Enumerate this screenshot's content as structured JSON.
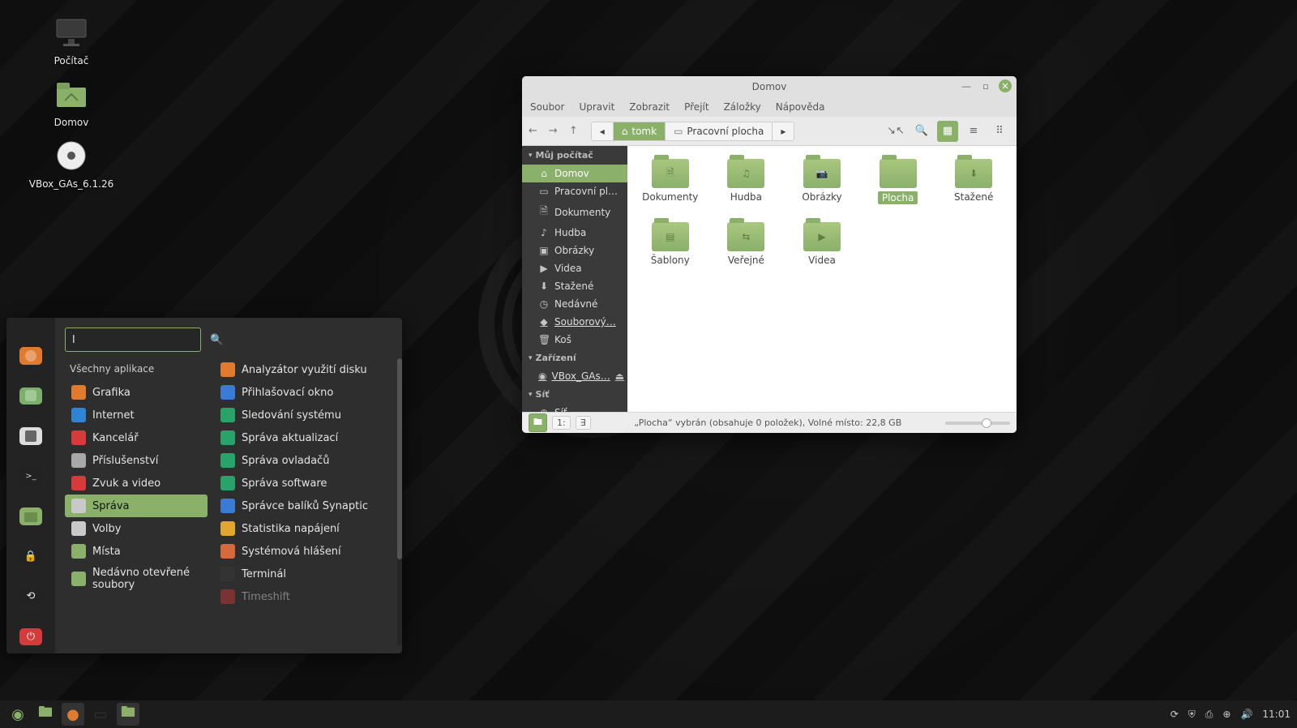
{
  "desktop": {
    "icons": [
      {
        "name": "computer",
        "label": "Počítač"
      },
      {
        "name": "home",
        "label": "Domov"
      },
      {
        "name": "disc",
        "label": "VBox_GAs_6.1.26"
      }
    ]
  },
  "start_menu": {
    "search_value": "l",
    "heading": "Všechny aplikace",
    "rail": [
      "firefox",
      "software",
      "settings",
      "terminal",
      "files",
      "lock",
      "logout",
      "power"
    ],
    "categories": [
      {
        "id": "grafika",
        "label": "Grafika",
        "color": "#e07a2f"
      },
      {
        "id": "internet",
        "label": "Internet",
        "color": "#2f84d6"
      },
      {
        "id": "kancelar",
        "label": "Kancelář",
        "color": "#d63a3a"
      },
      {
        "id": "prislusenstvi",
        "label": "Příslušenství",
        "color": "#a8a8a8"
      },
      {
        "id": "zvuk-video",
        "label": "Zvuk a video",
        "color": "#d63a3a"
      },
      {
        "id": "sprava",
        "label": "Správa",
        "color": "#c9c9c9",
        "selected": true
      },
      {
        "id": "volby",
        "label": "Volby",
        "color": "#c9c9c9"
      },
      {
        "id": "mista",
        "label": "Místa",
        "color": "#8ab06a"
      },
      {
        "id": "nedavno",
        "label": "Nedávno otevřené soubory",
        "color": "#8ab06a"
      }
    ],
    "apps": [
      {
        "id": "disk-usage",
        "label": "Analyzátor využití disku",
        "color": "#e07a2f"
      },
      {
        "id": "login-window",
        "label": "Přihlašovací okno",
        "color": "#3a7bd6"
      },
      {
        "id": "sys-monitor",
        "label": "Sledování systému",
        "color": "#2aa36a"
      },
      {
        "id": "update-mgr",
        "label": "Správa aktualizací",
        "color": "#2aa36a"
      },
      {
        "id": "driver-mgr",
        "label": "Správa ovladačů",
        "color": "#2aa36a"
      },
      {
        "id": "software-mgr",
        "label": "Správa software",
        "color": "#2aa36a"
      },
      {
        "id": "synaptic",
        "label": "Správce balíků Synaptic",
        "color": "#3a7bd6"
      },
      {
        "id": "power-stats",
        "label": "Statistika napájení",
        "color": "#e0a62f"
      },
      {
        "id": "sys-reports",
        "label": "Systémová hlášení",
        "color": "#d66a3a"
      },
      {
        "id": "terminal",
        "label": "Terminál",
        "color": "#333"
      },
      {
        "id": "timeshift",
        "label": "Timeshift",
        "color": "#d63a3a",
        "dim": true
      }
    ]
  },
  "file_manager": {
    "title": "Domov",
    "menus": [
      "Soubor",
      "Upravit",
      "Zobrazit",
      "Přejít",
      "Záložky",
      "Nápověda"
    ],
    "path": {
      "home": "tomk",
      "crumb": "Pracovní plocha"
    },
    "sidebar": {
      "group_computer": "Můj počítač",
      "group_devices": "Zařízení",
      "group_network": "Síť",
      "items_computer": [
        {
          "id": "home",
          "label": "Domov",
          "icon": "⌂",
          "active": true
        },
        {
          "id": "desktop",
          "label": "Pracovní pl…",
          "icon": "▭"
        },
        {
          "id": "documents",
          "label": "Dokumenty",
          "icon": "🗎"
        },
        {
          "id": "music",
          "label": "Hudba",
          "icon": "♪"
        },
        {
          "id": "pictures",
          "label": "Obrázky",
          "icon": "▣"
        },
        {
          "id": "videos",
          "label": "Videa",
          "icon": "▶"
        },
        {
          "id": "downloads",
          "label": "Stažené",
          "icon": "⬇"
        },
        {
          "id": "recent",
          "label": "Nedávné",
          "icon": "◷"
        },
        {
          "id": "filesystem",
          "label": "Souborový…",
          "icon": "◆",
          "link": true
        },
        {
          "id": "trash",
          "label": "Koš",
          "icon": "🗑"
        }
      ],
      "items_devices": [
        {
          "id": "vbox",
          "label": "VBox_GAs…",
          "icon": "◉",
          "link": true,
          "eject": true
        }
      ],
      "items_network": [
        {
          "id": "network",
          "label": "Síť",
          "icon": "⊕"
        }
      ]
    },
    "folders": [
      {
        "id": "dokumenty",
        "label": "Dokumenty",
        "glyph": "🗎"
      },
      {
        "id": "hudba",
        "label": "Hudba",
        "glyph": "♫"
      },
      {
        "id": "obrazky",
        "label": "Obrázky",
        "glyph": "📷"
      },
      {
        "id": "plocha",
        "label": "Plocha",
        "glyph": "",
        "selected": true
      },
      {
        "id": "stazene",
        "label": "Stažené",
        "glyph": "⬇"
      },
      {
        "id": "sablony",
        "label": "Šablony",
        "glyph": "▤"
      },
      {
        "id": "verejne",
        "label": "Veřejné",
        "glyph": "⇆"
      },
      {
        "id": "videa",
        "label": "Videa",
        "glyph": "▶"
      }
    ],
    "status": "„Plocha“ vybrán (obsahuje 0 položek), Volné místo: 22,8 GB",
    "status_btn1": "1:",
    "status_btn2": "∃"
  },
  "panel": {
    "clock": "11:01",
    "launchers": [
      {
        "id": "menu",
        "color": "#8ab06a",
        "glyph": "◉"
      },
      {
        "id": "files",
        "color": "#8ab06a",
        "glyph": "🖿"
      },
      {
        "id": "firefox",
        "color": "#e07a2f",
        "glyph": "●",
        "active": true
      },
      {
        "id": "terminal",
        "color": "#333",
        "glyph": "▭"
      },
      {
        "id": "files2",
        "color": "#8ab06a",
        "glyph": "🖿",
        "active": true
      }
    ],
    "tray": [
      "update",
      "shield",
      "printer",
      "network",
      "volume"
    ]
  },
  "colors": {
    "accent": "#8ab06a"
  }
}
